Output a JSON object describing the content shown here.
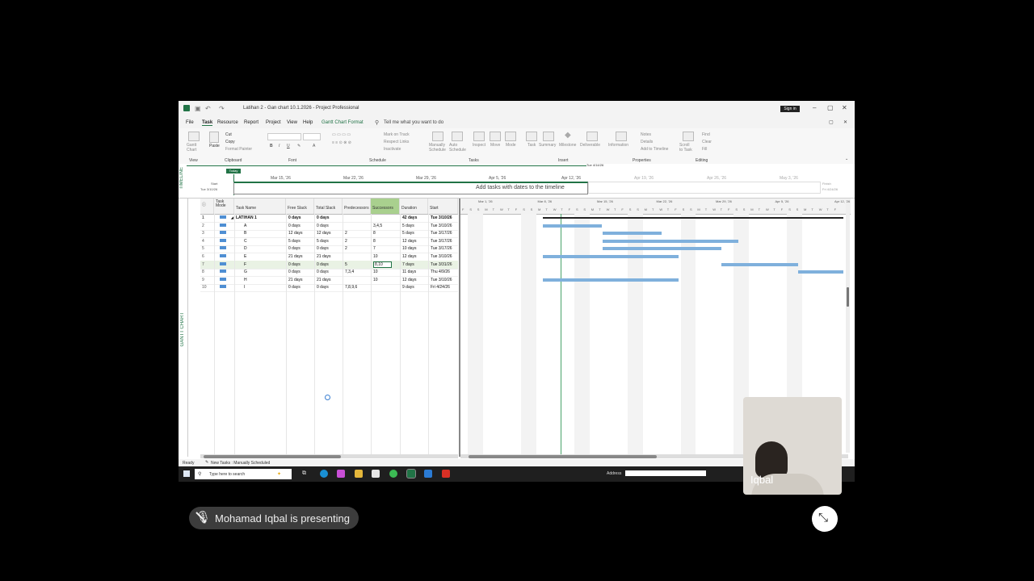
{
  "window": {
    "title": "Latihan 2 - Gan chart 10.1.2026  -  Project Professional",
    "sign_in": "Sign in"
  },
  "menu": {
    "items": [
      "File",
      "Task",
      "Resource",
      "Report",
      "Project",
      "View",
      "Help",
      "Gantt Chart Format"
    ],
    "active": "Task",
    "tell_me": "Tell me what you want to do"
  },
  "ribbon": {
    "groups": [
      "View",
      "Clipboard",
      "Font",
      "Schedule",
      "Tasks",
      "Insert",
      "Properties",
      "Editing"
    ],
    "clipboard": {
      "paste": "Paste",
      "cut": "Cut",
      "copy": "Copy",
      "format_painter": "Format Painter"
    },
    "gantt_chart": "Gantt Chart",
    "schedule": {
      "mark_on_track": "Mark on Track",
      "respect_links": "Respect Links",
      "inactivate": "Inactivate"
    },
    "tasks": {
      "manually": "Manually Schedule",
      "auto": "Auto Schedule",
      "inspect": "Inspect",
      "move": "Move",
      "mode": "Mode"
    },
    "insert": {
      "task": "Task",
      "summary": "Summary",
      "milestone": "Milestone",
      "deliverable": "Deliverable"
    },
    "properties": {
      "information": "Information",
      "notes": "Notes",
      "details": "Details",
      "add_to_timeline": "Add to Timeline"
    },
    "editing": {
      "scroll_to_task": "Scroll to Task",
      "find": "Find",
      "clear": "Clear",
      "fill": "Fill"
    }
  },
  "timeline": {
    "label": "TIMELINE",
    "today": "Today",
    "start_label": "Start",
    "start_date": "Tue 3/10/26",
    "finish_label": "Finish",
    "finish_date": "Fri 4/24/26",
    "hint": "Add tasks with dates to the timeline",
    "marker": "Tue 4/14/26",
    "dates": [
      "Mar 15, '26",
      "Mar 22, '26",
      "Mar 29, '26",
      "Apr 5, '26",
      "Apr 12, '26",
      "Apr 19, '26",
      "Apr 26, '26",
      "May 3, '26"
    ]
  },
  "grid": {
    "side_label": "GANTT CHART",
    "columns": [
      "Task Mode",
      "Task Name",
      "Free Slack",
      "Total Slack",
      "Predecessors",
      "Successors",
      "Duration",
      "Start"
    ],
    "rows": [
      {
        "id": "1",
        "name": "LATIHAN 1",
        "free": "0 days",
        "total": "0 days",
        "pred": "",
        "succ": "",
        "dur": "42 days",
        "start": "Tue 3/10/26",
        "summary": true
      },
      {
        "id": "2",
        "name": "A",
        "free": "0 days",
        "total": "0 days",
        "pred": "",
        "succ": "3,4,5",
        "dur": "5 days",
        "start": "Tue 3/10/26"
      },
      {
        "id": "3",
        "name": "B",
        "free": "12 days",
        "total": "12 days",
        "pred": "2",
        "succ": "8",
        "dur": "5 days",
        "start": "Tue 3/17/26"
      },
      {
        "id": "4",
        "name": "C",
        "free": "5 days",
        "total": "5 days",
        "pred": "2",
        "succ": "8",
        "dur": "12 days",
        "start": "Tue 3/17/26"
      },
      {
        "id": "5",
        "name": "D",
        "free": "0 days",
        "total": "0 days",
        "pred": "2",
        "succ": "7",
        "dur": "10 days",
        "start": "Tue 3/17/26"
      },
      {
        "id": "6",
        "name": "E",
        "free": "21 days",
        "total": "21 days",
        "pred": "",
        "succ": "10",
        "dur": "12 days",
        "start": "Tue 3/10/26"
      },
      {
        "id": "7",
        "name": "F",
        "free": "0 days",
        "total": "0 days",
        "pred": "5",
        "succ": "8,10",
        "dur": "7 days",
        "start": "Tue 3/31/26",
        "selected": true
      },
      {
        "id": "8",
        "name": "G",
        "free": "0 days",
        "total": "0 days",
        "pred": "7,3,4",
        "succ": "10",
        "dur": "11 days",
        "start": "Thu 4/9/26"
      },
      {
        "id": "9",
        "name": "H",
        "free": "21 days",
        "total": "21 days",
        "pred": "",
        "succ": "10",
        "dur": "12 days",
        "start": "Tue 3/10/26"
      },
      {
        "id": "10",
        "name": "I",
        "free": "0 days",
        "total": "0 days",
        "pred": "7,8,9,6",
        "succ": "",
        "dur": "9 days",
        "start": "Fri 4/24/26"
      }
    ]
  },
  "gantt": {
    "week_labels": [
      "Mar 1, '26",
      "Mar 8, '26",
      "Mar 15, '26",
      "Mar 22, '26",
      "Mar 29, '26",
      "Apr 5, '26",
      "Apr 12, '26"
    ],
    "day_letters": [
      "F",
      "S",
      "S",
      "M",
      "T",
      "W",
      "T",
      "F",
      "S",
      "S",
      "M",
      "T",
      "W",
      "T",
      "F",
      "S",
      "S",
      "M",
      "T",
      "W",
      "T",
      "F",
      "S",
      "S",
      "M",
      "T",
      "W",
      "T",
      "F",
      "S",
      "S",
      "M",
      "T",
      "W",
      "T",
      "F",
      "S",
      "S",
      "M",
      "T",
      "W",
      "T",
      "F",
      "S",
      "S",
      "M",
      "T",
      "W",
      "T",
      "F",
      "S"
    ]
  },
  "status": {
    "ready": "Ready",
    "new_tasks": "New Tasks : Manually Scheduled"
  },
  "taskbar": {
    "search": "Type here to search",
    "address": "Address"
  },
  "meeting": {
    "presenter_name": "Iqbal",
    "banner": "Mohamad Iqbal is presenting"
  }
}
